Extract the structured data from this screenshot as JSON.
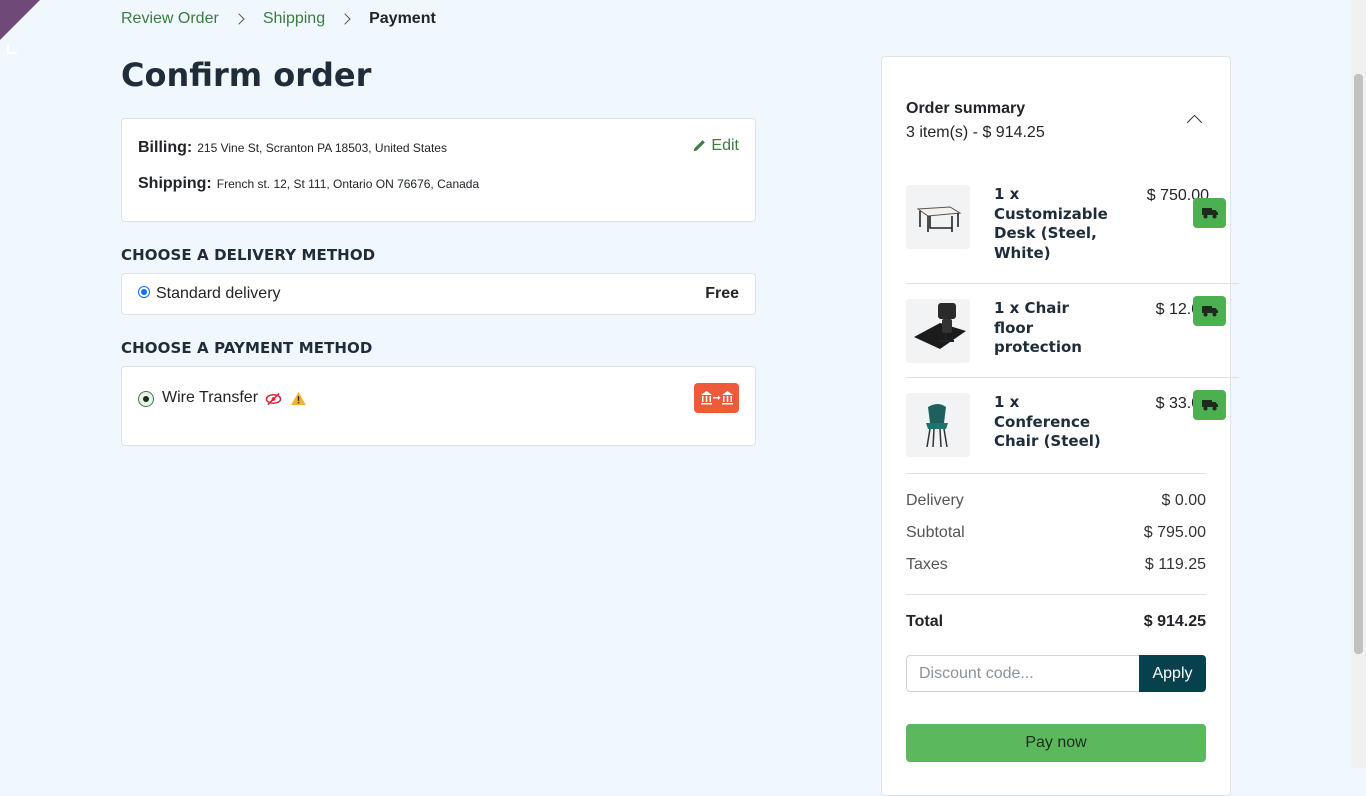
{
  "breadcrumb": {
    "step1": "Review Order",
    "step2": "Shipping",
    "step3": "Payment"
  },
  "page_title": "Confirm order",
  "address": {
    "billing_label": "Billing:",
    "billing_value": "215 Vine St, Scranton PA 18503, United States",
    "shipping_label": "Shipping:",
    "shipping_value": "French st. 12, St 111, Ontario ON 76676, Canada",
    "edit_label": "Edit"
  },
  "delivery": {
    "heading": "CHOOSE A DELIVERY METHOD",
    "method": "Standard delivery",
    "price": "Free"
  },
  "payment": {
    "heading": "CHOOSE A PAYMENT METHOD",
    "method": "Wire Transfer"
  },
  "summary": {
    "title": "Order summary",
    "count": "3 item(s) -  $ 914.25",
    "items": [
      {
        "name": "1 x Customizable Desk (Steel, White)",
        "price": "$ 750.00"
      },
      {
        "name": "1 x Chair floor protection",
        "price": "$ 12.00"
      },
      {
        "name": "1 x Conference Chair (Steel)",
        "price": "$ 33.00"
      }
    ],
    "delivery_label": "Delivery",
    "delivery_value": "$ 0.00",
    "subtotal_label": "Subtotal",
    "subtotal_value": "$ 795.00",
    "taxes_label": "Taxes",
    "taxes_value": "$ 119.25",
    "total_label": "Total",
    "total_value": "$ 914.25",
    "discount_placeholder": "Discount code...",
    "apply_label": "Apply",
    "pay_now_label": "Pay now"
  },
  "colors": {
    "accent_green": "#3b7d43",
    "pay_button": "#5cb85c",
    "apply_button": "#07414e",
    "bank_icon_bg": "#ef5b3a"
  },
  "icons": [
    "chevron-right-icon",
    "pencil-icon",
    "eye-slash-icon",
    "warning-icon",
    "bank-transfer-icon",
    "chevron-up-icon",
    "truck-icon"
  ]
}
